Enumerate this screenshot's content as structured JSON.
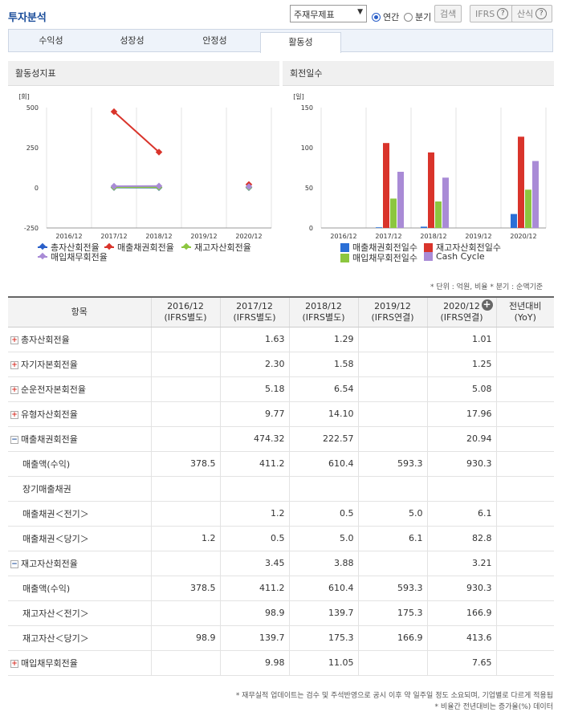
{
  "header": {
    "title": "투자분석",
    "select_value": "주재무제표",
    "radio_annual": "연간",
    "radio_quarter": "분기",
    "search_btn": "검색",
    "ifrs_btn": "IFRS",
    "formula_btn": "산식"
  },
  "tabs": [
    "수익성",
    "성장성",
    "안정성",
    "활동성"
  ],
  "active_tab": "활동성",
  "chart1": {
    "title": "활동성지표",
    "unit": "[회]",
    "yticks": [
      "500",
      "250",
      "0",
      "-250"
    ],
    "categories": [
      "2016/12",
      "2017/12",
      "2018/12",
      "2019/12",
      "2020/12"
    ],
    "legend": [
      "총자산회전율",
      "매출채권회전율",
      "재고자산회전율",
      "매입채무회전율"
    ]
  },
  "chart2": {
    "title": "회전일수",
    "unit": "[일]",
    "yticks": [
      "150",
      "100",
      "50",
      "0"
    ],
    "categories": [
      "2016/12",
      "2017/12",
      "2018/12",
      "2019/12",
      "2020/12"
    ],
    "legend": [
      "매출채권회전일수",
      "재고자산회전일수",
      "매입채무회전일수",
      "Cash Cycle"
    ]
  },
  "chart_data": [
    {
      "type": "line",
      "title": "활동성지표",
      "ylabel": "[회]",
      "ylim": [
        -250,
        500
      ],
      "categories": [
        "2016/12",
        "2017/12",
        "2018/12",
        "2019/12",
        "2020/12"
      ],
      "series": [
        {
          "name": "총자산회전율",
          "color": "#2a5fc9",
          "values": [
            null,
            1.63,
            1.29,
            null,
            1.01
          ]
        },
        {
          "name": "매출채권회전율",
          "color": "#d9342b",
          "values": [
            null,
            474.32,
            222.57,
            null,
            20.94
          ]
        },
        {
          "name": "재고자산회전율",
          "color": "#8cc63f",
          "values": [
            null,
            3.45,
            3.88,
            null,
            3.21
          ]
        },
        {
          "name": "매입채무회전율",
          "color": "#a98bd6",
          "values": [
            null,
            9.98,
            11.05,
            null,
            7.65
          ]
        }
      ]
    },
    {
      "type": "bar",
      "title": "회전일수",
      "ylabel": "[일]",
      "ylim": [
        0,
        150
      ],
      "categories": [
        "2016/12",
        "2017/12",
        "2018/12",
        "2019/12",
        "2020/12"
      ],
      "series": [
        {
          "name": "매출채권회전일수",
          "color": "#2a6fd6",
          "values": [
            0,
            0.8,
            1.6,
            0,
            17.4
          ]
        },
        {
          "name": "재고자산회전일수",
          "color": "#d9342b",
          "values": [
            0,
            105.8,
            94.1,
            0,
            113.7
          ]
        },
        {
          "name": "매입채무회전일수",
          "color": "#8cc63f",
          "values": [
            0,
            36.6,
            33.0,
            0,
            47.7
          ]
        },
        {
          "name": "Cash Cycle",
          "color": "#a98bd6",
          "values": [
            0,
            70.0,
            62.7,
            0,
            83.4
          ]
        }
      ]
    }
  ],
  "note": "* 단위 : 억원, 비율   * 분기 : 순액기준",
  "table": {
    "headers": [
      [
        "항목"
      ],
      [
        "2016/12",
        "(IFRS별도)"
      ],
      [
        "2017/12",
        "(IFRS별도)"
      ],
      [
        "2018/12",
        "(IFRS별도)"
      ],
      [
        "2019/12",
        "(IFRS연결)"
      ],
      [
        "2020/12",
        "(IFRS연결)"
      ],
      [
        "전년대비",
        "(YoY)"
      ]
    ],
    "rows": [
      {
        "label": "총자산회전율",
        "tog": "plus",
        "vals": [
          "",
          "1.63",
          "1.29",
          "",
          "1.01",
          ""
        ]
      },
      {
        "label": "자기자본회전율",
        "tog": "plus",
        "vals": [
          "",
          "2.30",
          "1.58",
          "",
          "1.25",
          ""
        ]
      },
      {
        "label": "순운전자본회전율",
        "tog": "plus",
        "vals": [
          "",
          "5.18",
          "6.54",
          "",
          "5.08",
          ""
        ]
      },
      {
        "label": "유형자산회전율",
        "tog": "plus",
        "vals": [
          "",
          "9.77",
          "14.10",
          "",
          "17.96",
          ""
        ]
      },
      {
        "label": "매출채권회전율",
        "tog": "minus",
        "vals": [
          "",
          "474.32",
          "222.57",
          "",
          "20.94",
          ""
        ]
      },
      {
        "label": "매출액(수익)",
        "tog": "",
        "vals": [
          "378.5",
          "411.2",
          "610.4",
          "593.3",
          "930.3",
          ""
        ]
      },
      {
        "label": "장기매출채권",
        "tog": "",
        "vals": [
          "",
          "",
          "",
          "",
          "",
          ""
        ]
      },
      {
        "label": "매출채권＜전기＞",
        "tog": "",
        "vals": [
          "",
          "1.2",
          "0.5",
          "5.0",
          "6.1",
          ""
        ]
      },
      {
        "label": "매출채권＜당기＞",
        "tog": "",
        "vals": [
          "1.2",
          "0.5",
          "5.0",
          "6.1",
          "82.8",
          ""
        ]
      },
      {
        "label": "재고자산회전율",
        "tog": "minus",
        "vals": [
          "",
          "3.45",
          "3.88",
          "",
          "3.21",
          ""
        ]
      },
      {
        "label": "매출액(수익)",
        "tog": "",
        "vals": [
          "378.5",
          "411.2",
          "610.4",
          "593.3",
          "930.3",
          ""
        ]
      },
      {
        "label": "재고자산＜전기＞",
        "tog": "",
        "vals": [
          "",
          "98.9",
          "139.7",
          "175.3",
          "166.9",
          ""
        ]
      },
      {
        "label": "재고자산＜당기＞",
        "tog": "",
        "vals": [
          "98.9",
          "139.7",
          "175.3",
          "166.9",
          "413.6",
          ""
        ]
      },
      {
        "label": "매입채무회전율",
        "tog": "plus",
        "vals": [
          "",
          "9.98",
          "11.05",
          "",
          "7.65",
          ""
        ]
      }
    ]
  },
  "footer": [
    "* 재무실적 업데이트는 검수 및 주석반영으로 공시 이후 약 일주일 정도 소요되며, 기업별로 다르게 적용됩",
    "* 비율간 전년대비는 증가율(%) 데이터"
  ]
}
